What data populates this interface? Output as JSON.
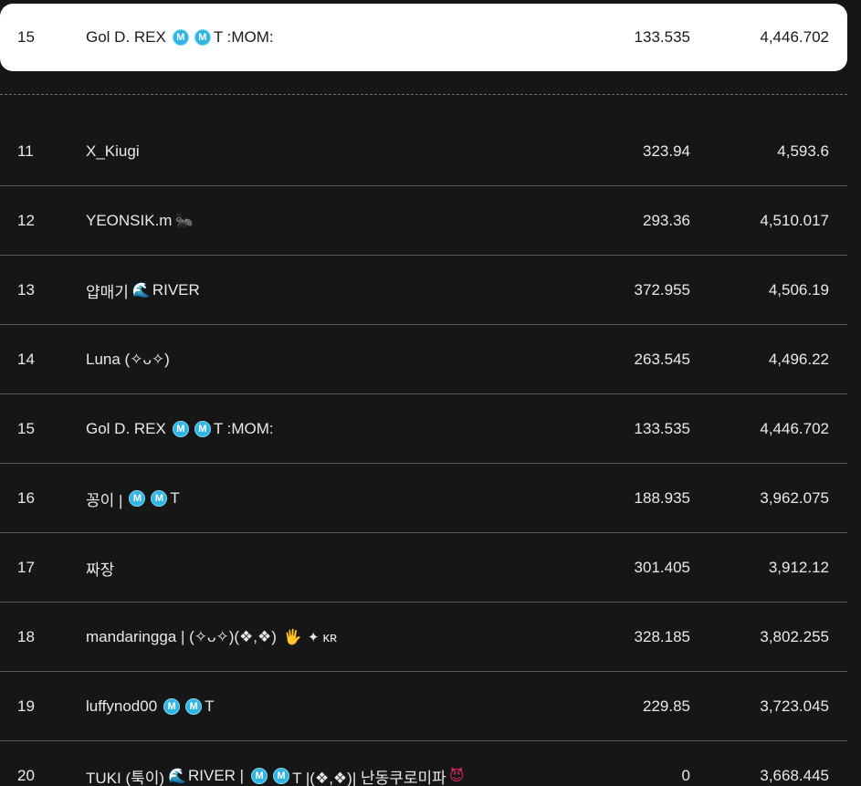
{
  "highlight": {
    "rank": "15",
    "name_parts": [
      "Gol D. REX",
      "M",
      "M",
      "T :MOM:"
    ],
    "score": "133.535",
    "total": "4,446.702"
  },
  "rows": [
    {
      "rank": "11",
      "name": "X_Kiugi",
      "score": "323.94",
      "total": "4,593.6"
    },
    {
      "rank": "12",
      "name": "YEONSIK.m",
      "emoji": "🐜",
      "score": "293.36",
      "total": "4,510.017"
    },
    {
      "rank": "13",
      "name_pre": "얍매기 ",
      "emoji": "🌊",
      "name_post": "RIVER",
      "score": "372.955",
      "total": "4,506.19"
    },
    {
      "rank": "14",
      "name": "Luna (✧ᴗ✧)",
      "score": "263.545",
      "total": "4,496.22"
    },
    {
      "rank": "15",
      "name_pre": "Gol D. REX",
      "badge1": "M",
      "badge2": "M",
      "name_post": "T :MOM:",
      "score": "133.535",
      "total": "4,446.702"
    },
    {
      "rank": "16",
      "name_pre": "꽁이 |",
      "badge1": "M",
      "badge2": "M",
      "name_post": "T",
      "score": "188.935",
      "total": "3,962.075"
    },
    {
      "rank": "17",
      "name": "짜장",
      "score": "301.405",
      "total": "3,912.12"
    },
    {
      "rank": "18",
      "name": "mandaringga | (✧ᴗ✧)(❖,❖)",
      "emoji": "🖐",
      "name_post": "✦ ᴋʀ",
      "score": "328.185",
      "total": "3,802.255"
    },
    {
      "rank": "19",
      "name_pre": "luffynod00",
      "badge1": "M",
      "badge2": "M",
      "name_post": "T",
      "score": "229.85",
      "total": "3,723.045"
    },
    {
      "rank": "20",
      "name_pre": "TUKI (툭이) ",
      "emoji": "🌊",
      "name_mid": "RIVER |",
      "badge1": "M",
      "badge2": "M",
      "name_post": "T |(❖,❖)| 난동쿠로미파",
      "emoji2": "😈",
      "score": "0",
      "total": "3,668.445"
    }
  ]
}
